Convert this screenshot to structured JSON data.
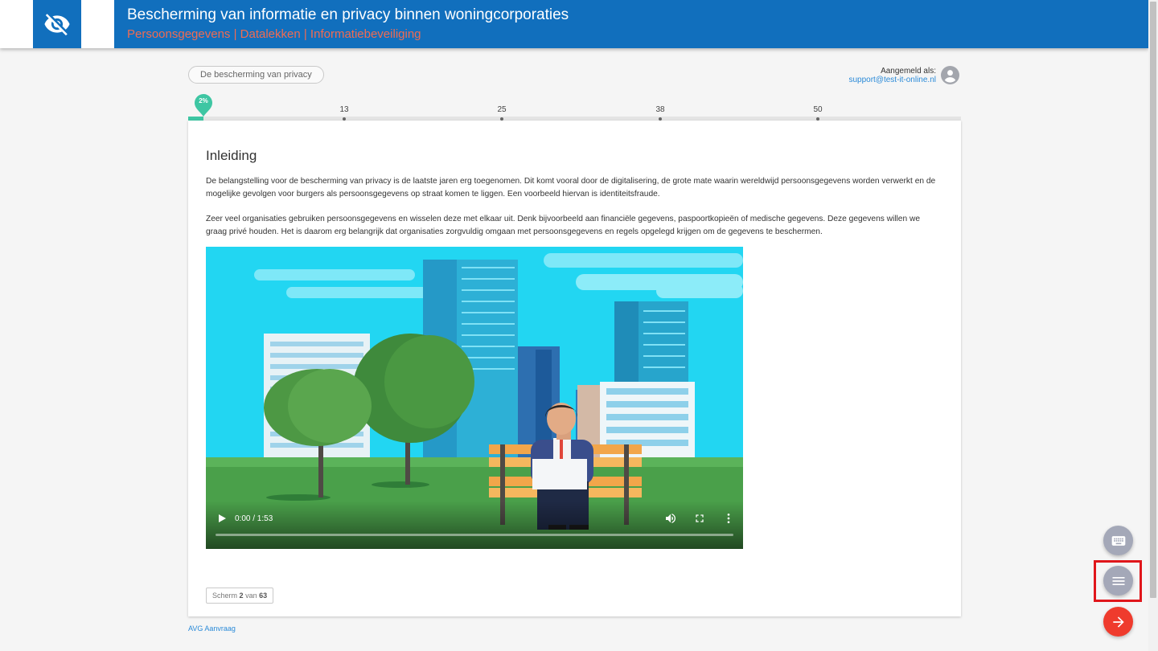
{
  "header": {
    "title": "Bescherming van informatie en privacy binnen woningcorporaties",
    "subtitle": "Persoonsgegevens | Datalekken | Informatiebeveiliging",
    "logo_icon": "eye-off-icon",
    "color": "#116fbd",
    "subtitle_color": "#f06b52"
  },
  "chapter": {
    "label": "De bescherming van privacy"
  },
  "user": {
    "label": "Aangemeld als:",
    "email": "support@test-it-online.nl",
    "avatar_icon": "account-circle-icon"
  },
  "progress": {
    "percent_label": "2%",
    "percent": 2,
    "ticks": [
      "13",
      "25",
      "38",
      "50"
    ],
    "accent": "#3ec6a3"
  },
  "content": {
    "heading": "Inleiding",
    "paragraph_1": "De belangstelling voor de bescherming van privacy is de laatste jaren erg toegenomen. Dit komt vooral door de digitalisering, de grote mate waarin wereldwijd persoonsgegevens worden verwerkt en de mogelijke gevolgen voor burgers als persoonsgegevens op straat komen te liggen. Een voorbeeld hiervan is identiteitsfraude.",
    "paragraph_2": "Zeer veel organisaties gebruiken persoonsgegevens en wisselen deze met elkaar uit. Denk bijvoorbeeld aan financiële gegevens, paspoortkopieën of medische gegevens. Deze gegevens willen we graag privé houden. Het is daarom erg belangrijk dat organisaties zorgvuldig omgaan met persoonsgegevens en regels opgelegd krijgen om de gegevens te beschermen."
  },
  "video": {
    "time": "0:00 / 1:53",
    "play_icon": "play-icon",
    "volume_icon": "volume-icon",
    "fullscreen_icon": "fullscreen-icon",
    "more_icon": "more-vert-icon"
  },
  "screen_counter": {
    "prefix": "Scherm",
    "current": "2",
    "middle": "van",
    "total": "63"
  },
  "footer": {
    "link": "AVG Aanvraag"
  },
  "fabs": {
    "keyboard_icon": "keyboard-icon",
    "menu_icon": "menu-icon",
    "next_icon": "arrow-right-icon",
    "next_color": "#ef3b2d"
  }
}
